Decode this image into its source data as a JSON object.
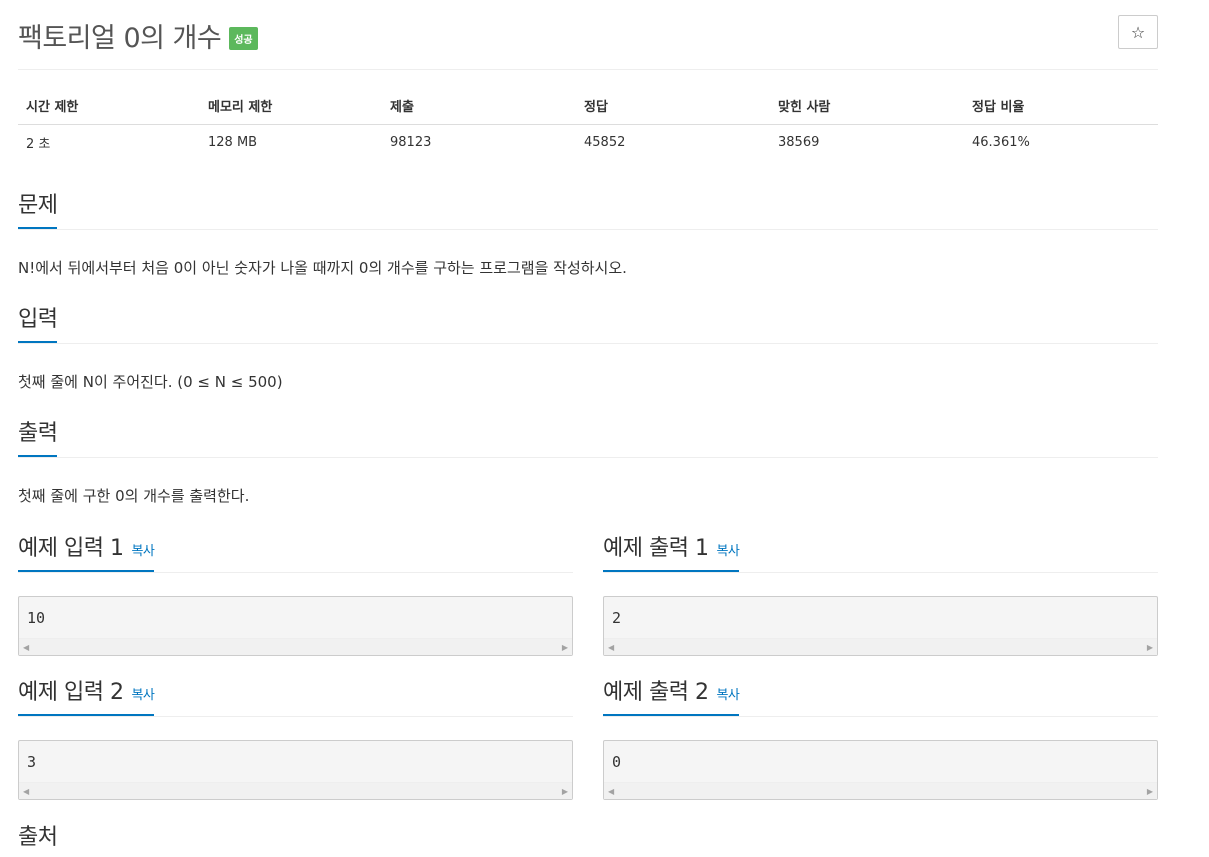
{
  "problem": {
    "title": "팩토리얼 0의 개수",
    "status_badge": "성공",
    "star_icon": "☆"
  },
  "info_table": {
    "headers": [
      "시간 제한",
      "메모리 제한",
      "제출",
      "정답",
      "맞힌 사람",
      "정답 비율"
    ],
    "values": [
      "2 초",
      "128 MB",
      "98123",
      "45852",
      "38569",
      "46.361%"
    ]
  },
  "sections": {
    "description": {
      "title": "문제",
      "text": "N!에서 뒤에서부터 처음 0이 아닌 숫자가 나올 때까지 0의 개수를 구하는 프로그램을 작성하시오."
    },
    "input": {
      "title": "입력",
      "text": "첫째 줄에 N이 주어진다. (0 ≤ N ≤ 500)"
    },
    "output": {
      "title": "출력",
      "text": "첫째 줄에 구한 0의 개수를 출력한다."
    },
    "source": {
      "title": "출처"
    }
  },
  "samples": {
    "copy_label": "복사",
    "input_1": {
      "title": "예제 입력 1",
      "value": "10"
    },
    "output_1": {
      "title": "예제 출력 1",
      "value": "2"
    },
    "input_2": {
      "title": "예제 입력 2",
      "value": "3"
    },
    "output_2": {
      "title": "예제 출력 2",
      "value": "0"
    }
  },
  "colors": {
    "accent": "#0076c0",
    "badge_success": "#5cb85c"
  }
}
